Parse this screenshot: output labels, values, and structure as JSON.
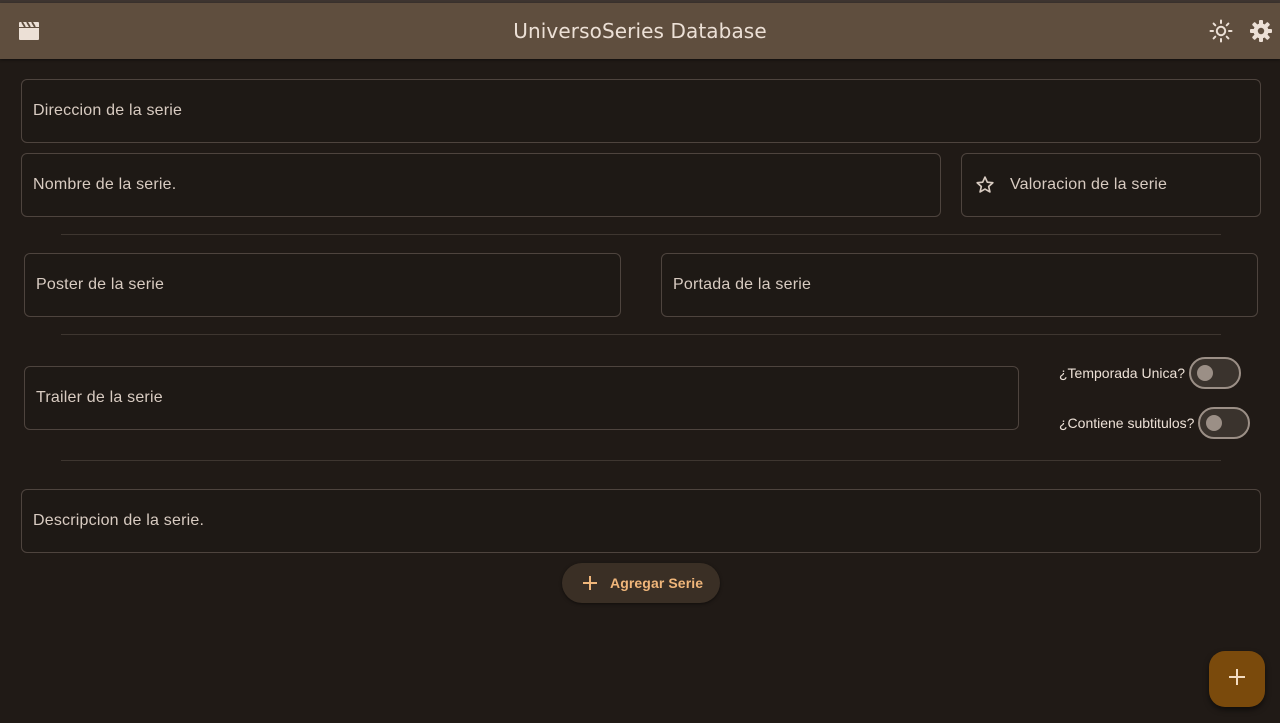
{
  "app": {
    "title": "UniversoSeries Database",
    "logo_icon": "clapperboard-icon",
    "actions": [
      {
        "icon": "sun-icon",
        "purpose": "toggle theme"
      },
      {
        "icon": "gear-icon",
        "purpose": "settings"
      }
    ]
  },
  "form": {
    "direccion_placeholder": "Direccion de la serie",
    "nombre_placeholder": "Nombre de la serie.",
    "valoracion_placeholder": "Valoracion de la serie",
    "valoracion_icon": "star-outline-icon",
    "poster_placeholder": "Poster de la serie",
    "portada_placeholder": "Portada de la serie",
    "trailer_placeholder": "Trailer de la serie",
    "temporada_unica_label": "¿Temporada Unica?",
    "temporada_unica_value": false,
    "subtitulos_label": "¿Contiene subtitulos?",
    "subtitulos_value": false,
    "descripcion_placeholder": "Descripcion de la serie.",
    "submit_label": "Agregar Serie",
    "submit_icon": "plus-icon"
  },
  "fab": {
    "icon": "plus-icon"
  },
  "colors": {
    "appbar": "#5f4e3e",
    "background": "#201a16",
    "accent": "#f0b67a",
    "fab": "#7a4a0c"
  }
}
